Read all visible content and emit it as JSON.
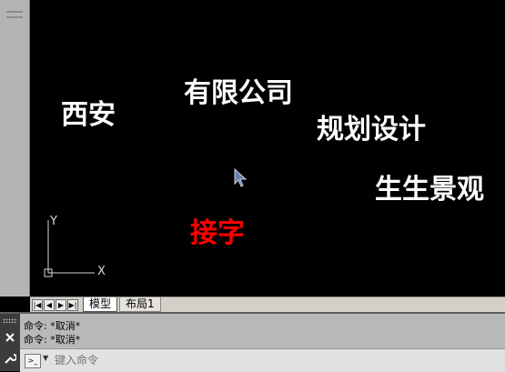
{
  "drawing": {
    "texts": [
      {
        "text": "西安",
        "color": "#ffffff"
      },
      {
        "text": "有限公司",
        "color": "#ffffff"
      },
      {
        "text": "规划设计",
        "color": "#ffffff"
      },
      {
        "text": "生生景观",
        "color": "#ffffff"
      },
      {
        "text": "接字",
        "color": "#ff0000"
      }
    ],
    "ucs": {
      "y_label": "Y",
      "x_label": "X"
    }
  },
  "tabs": [
    {
      "label": "模型",
      "active": true
    },
    {
      "label": "布局1",
      "active": false
    }
  ],
  "command": {
    "history": [
      "命令: *取消*",
      "命令: *取消*"
    ],
    "placeholder": "键入命令",
    "prompt_icon": ">_"
  },
  "icons": {
    "close": "close-icon",
    "wrench": "wrench-icon",
    "cursor": "cursor-icon"
  },
  "colors": {
    "canvas_bg": "#000000",
    "text_white": "#ffffff",
    "text_red": "#ff0000",
    "panel_gray": "#b9b9b9"
  }
}
